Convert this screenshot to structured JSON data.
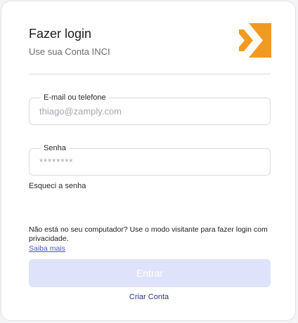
{
  "header": {
    "title": "Fazer login",
    "subtitle": "Use sua Conta INCI"
  },
  "logo": {
    "icon": "inci-logo-icon",
    "color": "#f29a1f"
  },
  "form": {
    "email": {
      "label": "E-mail ou telefone",
      "placeholder": "thiago@zamply.com",
      "value": ""
    },
    "password": {
      "label": "Senha",
      "placeholder": "********",
      "value": ""
    },
    "forgot_label": "Esqueci a senha"
  },
  "guest": {
    "message": "Não está no seu computador? Use o modo visitante para fazer login com privacidade.",
    "learn_more": "Saiba mais"
  },
  "actions": {
    "submit_label": "Entrar",
    "submit_color": "#dfe2fb",
    "create_label": "Criar Conta"
  }
}
